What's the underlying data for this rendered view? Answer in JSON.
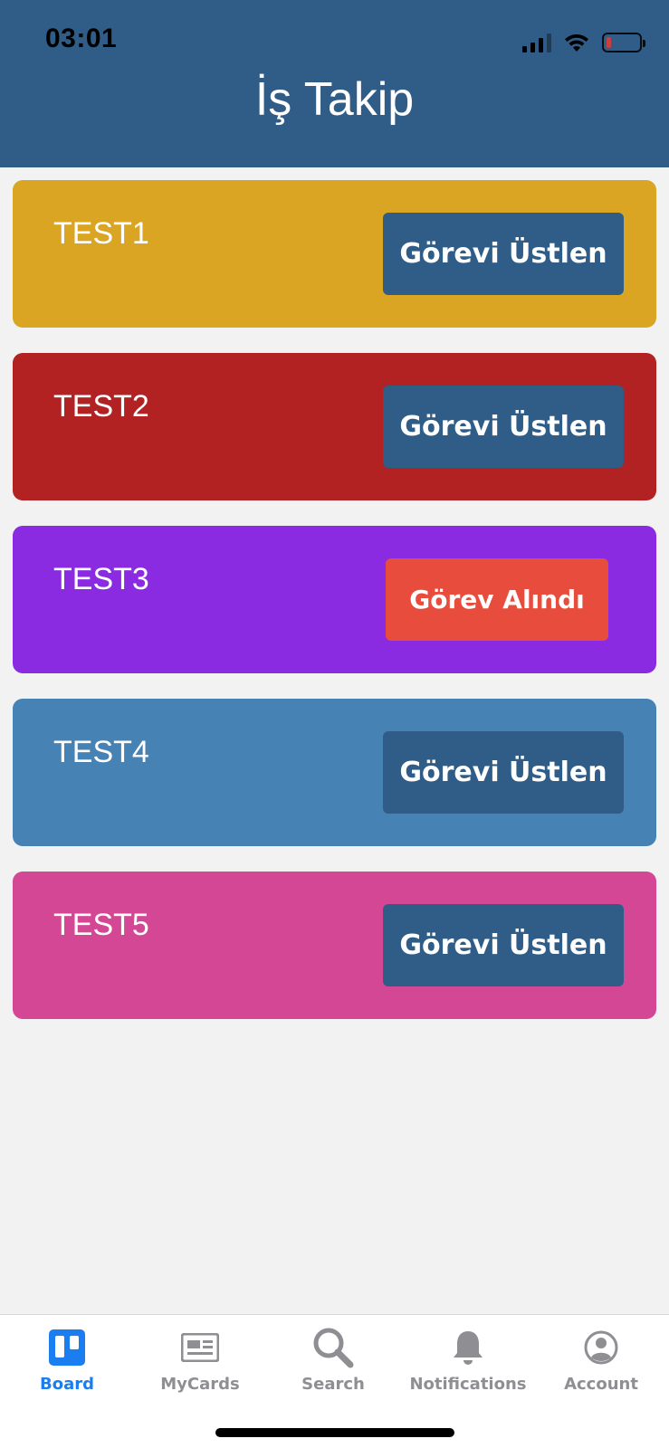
{
  "status_bar": {
    "time": "03:01"
  },
  "header": {
    "title": "İş Takip"
  },
  "cards": [
    {
      "title": "TEST1",
      "button": "Görevi Üstlen",
      "color": "#d9a522",
      "button_color": "#2f5d87",
      "state": "available"
    },
    {
      "title": "TEST2",
      "button": "Görevi Üstlen",
      "color": "#b22222",
      "button_color": "#2f5d87",
      "state": "available"
    },
    {
      "title": "TEST3",
      "button": "Görev Alındı",
      "color": "#8a2be2",
      "button_color": "#e84c3d",
      "state": "taken"
    },
    {
      "title": "TEST4",
      "button": "Görevi Üstlen",
      "color": "#4682b4",
      "button_color": "#2f5d87",
      "state": "available"
    },
    {
      "title": "TEST5",
      "button": "Görevi Üstlen",
      "color": "#d34795",
      "button_color": "#2f5d87",
      "state": "available"
    }
  ],
  "tabbar": {
    "active": "Board",
    "items": [
      {
        "label": "Board",
        "icon": "board-icon"
      },
      {
        "label": "MyCards",
        "icon": "cards-icon"
      },
      {
        "label": "Search",
        "icon": "search-icon"
      },
      {
        "label": "Notifications",
        "icon": "bell-icon"
      },
      {
        "label": "Account",
        "icon": "account-icon"
      }
    ]
  },
  "colors": {
    "header": "#2f5d87",
    "accent": "#1a7ef0",
    "inactive": "#8e8e93",
    "background": "#f2f2f2"
  }
}
